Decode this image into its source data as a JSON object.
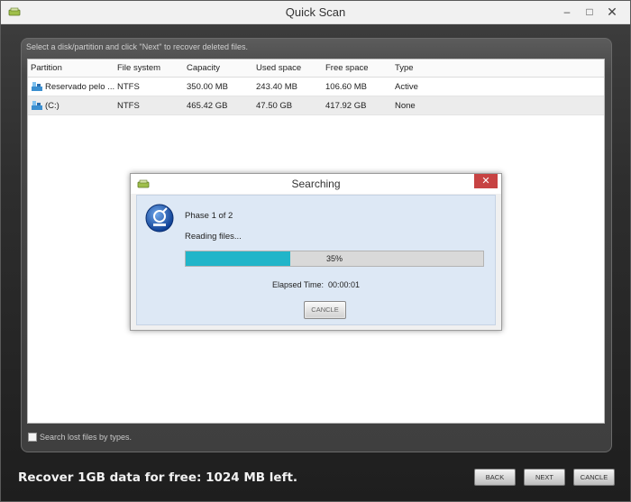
{
  "window": {
    "title": "Quick Scan"
  },
  "instruction": "Select a disk/partition and click \"Next\" to recover deleted files.",
  "table": {
    "headers": [
      "Partition",
      "File system",
      "Capacity",
      "Used space",
      "Free space",
      "Type"
    ],
    "rows": [
      [
        "Reservado pelo ...",
        "NTFS",
        "350.00 MB",
        "243.40 MB",
        "106.60 MB",
        "Active"
      ],
      [
        "(C:)",
        "NTFS",
        "465.42 GB",
        "47.50 GB",
        "417.92 GB",
        "None"
      ]
    ]
  },
  "dialog": {
    "title": "Searching",
    "close_icon": "close-icon",
    "phase": "Phase 1 of 2",
    "status": "Reading files...",
    "progress_percent": 35,
    "progress_label": "35%",
    "elapsed_label": "Elapsed Time:",
    "elapsed_value": "00:00:01",
    "cancel_label": "CANCLE"
  },
  "search_by_types": {
    "label": "Search lost files by types.",
    "checked": false
  },
  "footer": {
    "message": "Recover 1GB data for free: 1024 MB left.",
    "back_label": "BACK",
    "next_label": "NEXT",
    "cancel_label": "CANCLE"
  },
  "colors": {
    "progress_fill": "#21b5c9",
    "close_button": "#c74343",
    "dialog_body": "#dde8f5"
  }
}
